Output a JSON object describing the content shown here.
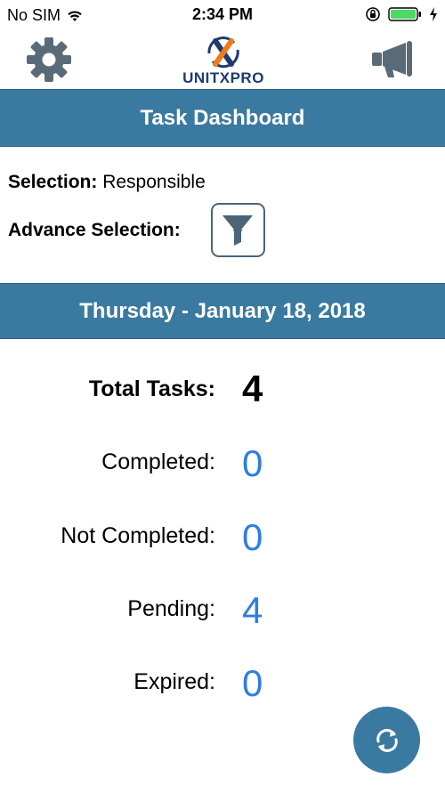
{
  "status_bar": {
    "carrier": "No SIM",
    "time": "2:34 PM"
  },
  "header": {
    "logo_text": "UNITXPRO",
    "icons": [
      "gear-icon",
      "megaphone-icon"
    ]
  },
  "title_banner": {
    "title": "Task Dashboard"
  },
  "selection": {
    "label": "Selection:",
    "value": "Responsible",
    "advance_label": "Advance Selection:"
  },
  "date_banner": {
    "date": "Thursday - January 18, 2018"
  },
  "stats": {
    "total_label": "Total Tasks:",
    "total_value": "4",
    "completed_label": "Completed:",
    "completed_value": "0",
    "not_completed_label": "Not Completed:",
    "not_completed_value": "0",
    "pending_label": "Pending:",
    "pending_value": "4",
    "expired_label": "Expired:",
    "expired_value": "0"
  },
  "colors": {
    "banner": "#3a7aa0",
    "value_blue": "#2d7ee0",
    "battery": "#4cd964",
    "logo_navy": "#1f3a6e",
    "logo_orange": "#f07a1a"
  }
}
